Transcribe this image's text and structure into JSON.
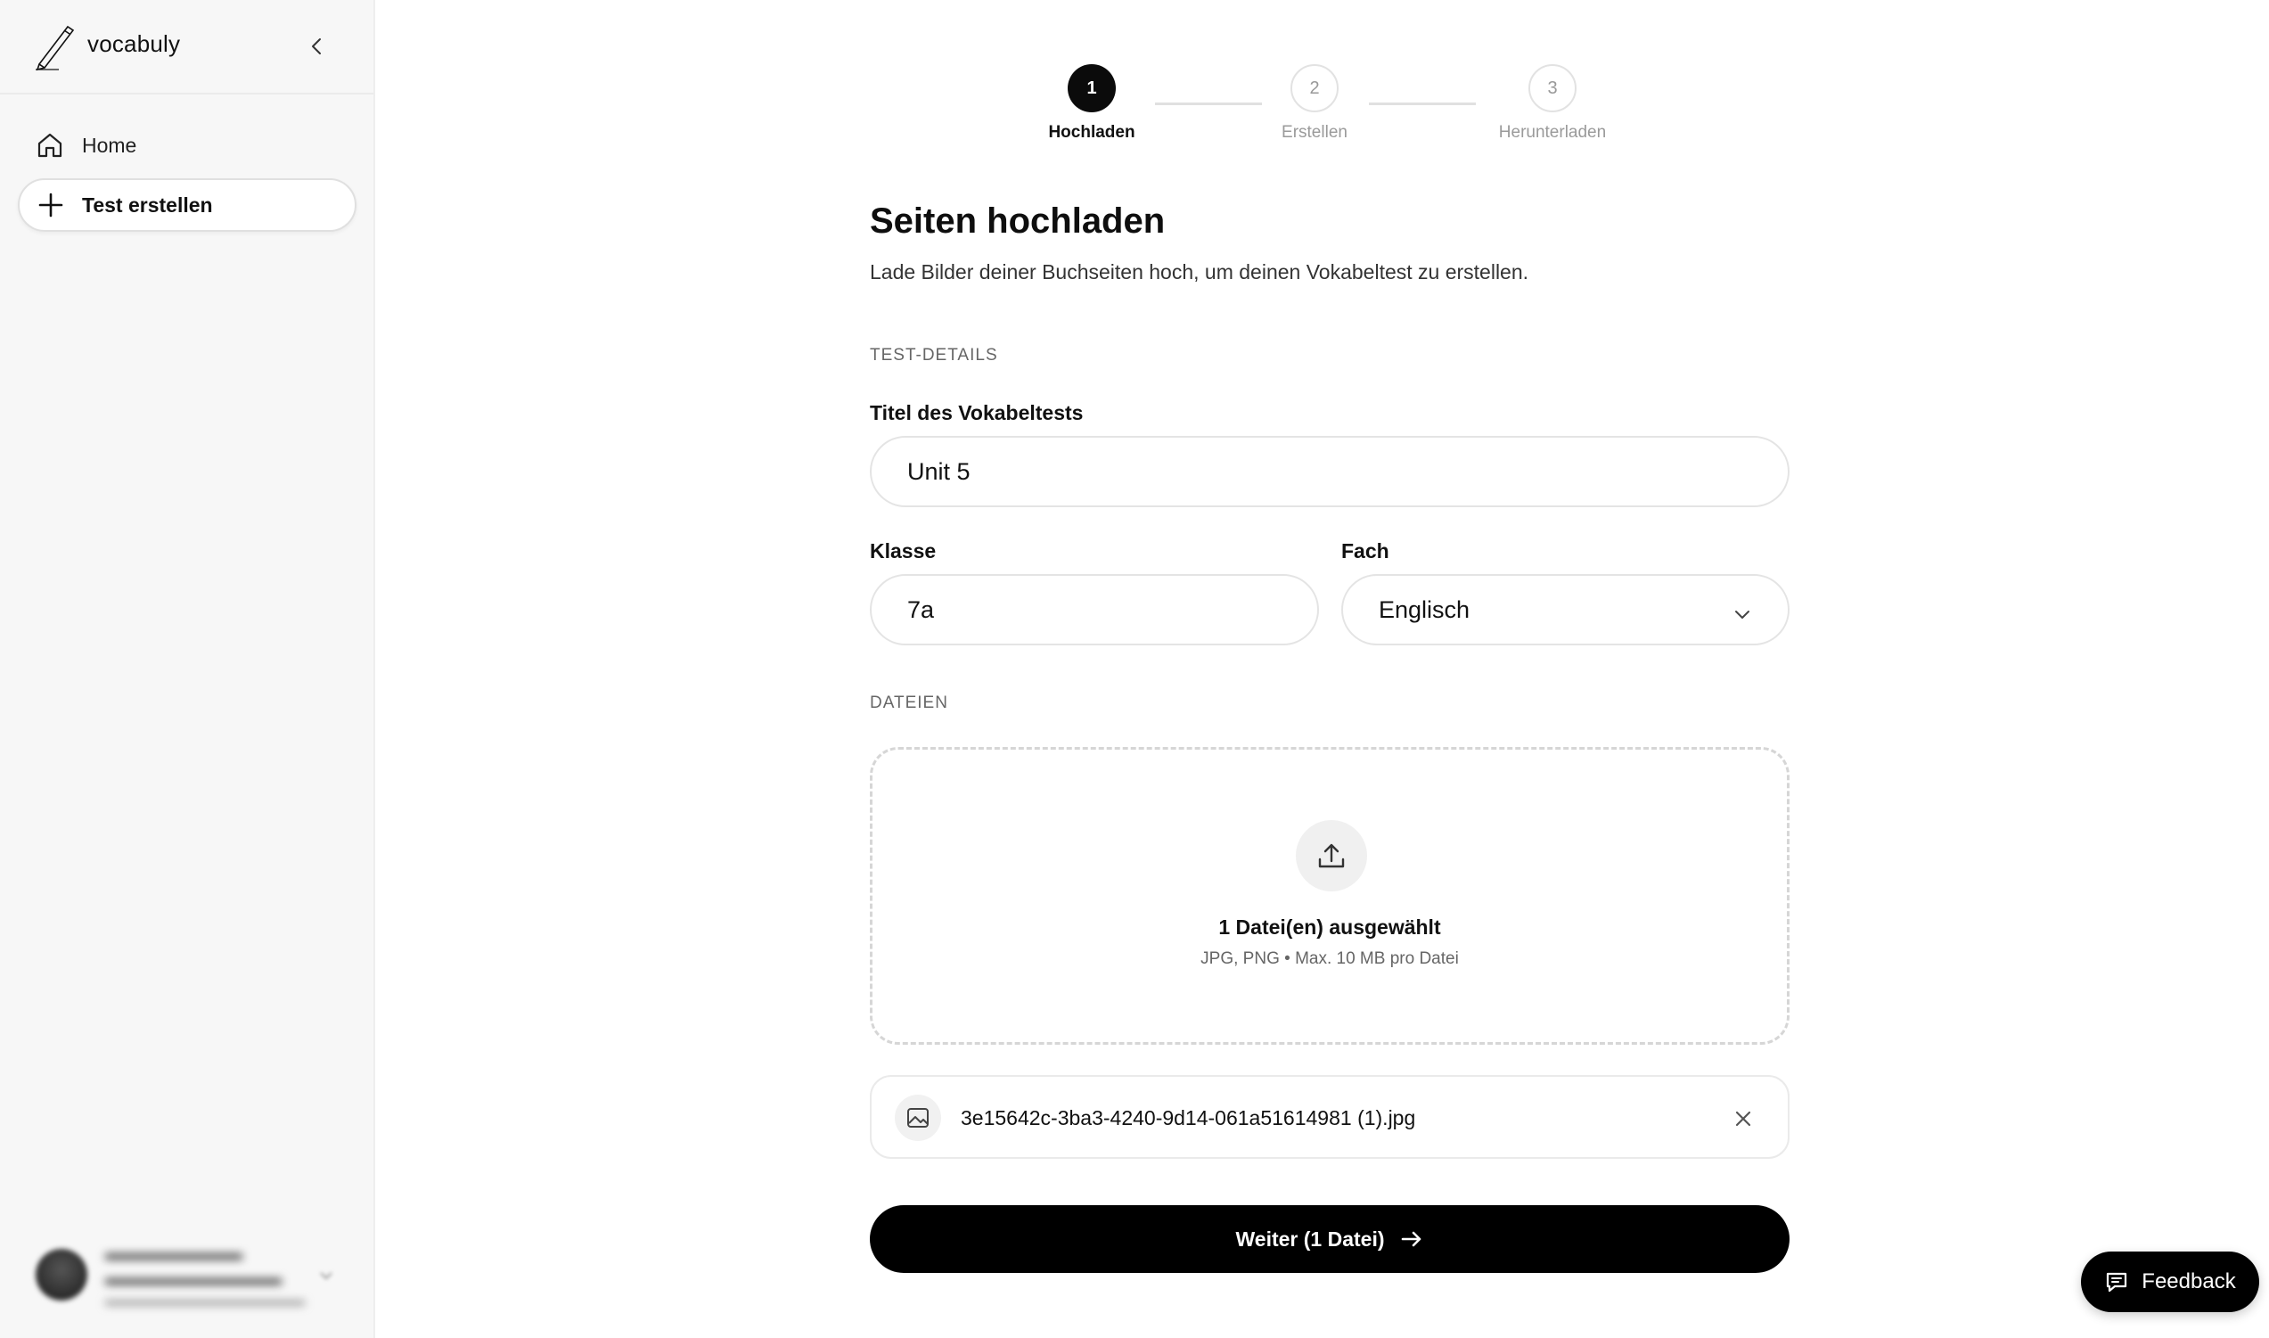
{
  "app": {
    "name": "vocabuly"
  },
  "sidebar": {
    "items": [
      {
        "label": "Home",
        "icon": "home-icon"
      },
      {
        "label": "Test erstellen",
        "icon": "plus-icon"
      }
    ]
  },
  "stepper": {
    "steps": [
      {
        "number": "1",
        "label": "Hochladen",
        "state": "active"
      },
      {
        "number": "2",
        "label": "Erstellen",
        "state": "inactive"
      },
      {
        "number": "3",
        "label": "Herunterladen",
        "state": "inactive"
      }
    ]
  },
  "page": {
    "title": "Seiten hochladen",
    "subtitle": "Lade Bilder deiner Buchseiten hoch, um deinen Vokabeltest zu erstellen."
  },
  "form": {
    "section_details": "TEST-DETAILS",
    "title_label": "Titel des Vokabeltests",
    "title_value": "Unit 5",
    "class_label": "Klasse",
    "class_value": "7a",
    "subject_label": "Fach",
    "subject_value": "Englisch",
    "section_files": "DATEIEN"
  },
  "dropzone": {
    "title": "1 Datei(en) ausgewählt",
    "subtitle": "JPG, PNG • Max. 10 MB pro Datei",
    "icon": "upload-icon"
  },
  "files": [
    {
      "name": "3e15642c-3ba3-4240-9d14-061a51614981 (1).jpg",
      "icon": "image-icon"
    }
  ],
  "actions": {
    "next_label": "Weiter (1 Datei)",
    "feedback_label": "Feedback"
  },
  "colors": {
    "accent": "#000000",
    "sidebar_bg": "#f7f7f7",
    "border": "#e4e4e4",
    "muted_text": "#9a9a9a"
  }
}
